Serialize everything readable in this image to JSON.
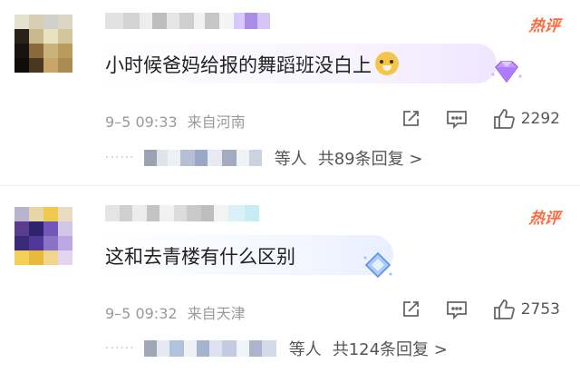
{
  "comments": [
    {
      "hot_badge": "热评",
      "content": "小时候爸妈给报的舞蹈班没白上",
      "emoji": "doge-emoji",
      "gem": "purple-diamond-badge",
      "time": "9–5 09:33",
      "location": "来自河南",
      "likes": "2292",
      "reply_people": "等人",
      "reply_count": "共89条回复 >"
    },
    {
      "hot_badge": "热评",
      "content": "这和去青楼有什么区别",
      "gem": "blue-diamond-badge",
      "time": "9–5 09:32",
      "location": "来自天津",
      "likes": "2753",
      "reply_people": "等人",
      "reply_count": "共124条回复 >"
    }
  ],
  "colors": {
    "hot": "#ff6a3d",
    "meta": "#9a9a9a",
    "content": "#222222",
    "gem_purple": "#b57cff",
    "gem_blue": "#7fb2ff"
  }
}
